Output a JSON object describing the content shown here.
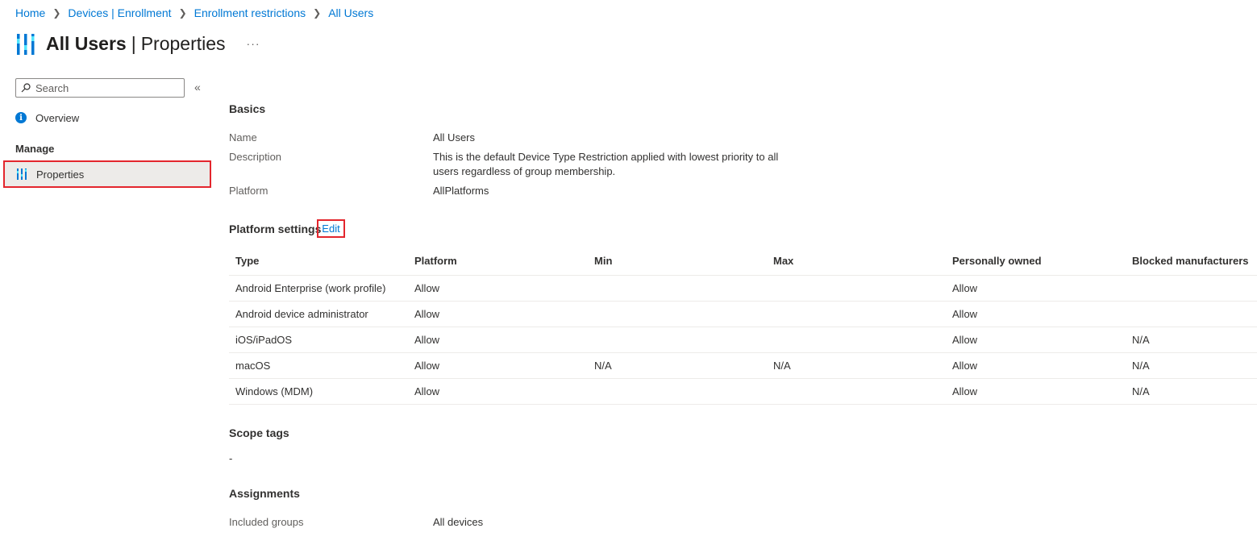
{
  "breadcrumb": [
    {
      "label": "Home"
    },
    {
      "label": "Devices | Enrollment"
    },
    {
      "label": "Enrollment restrictions"
    },
    {
      "label": "All Users"
    }
  ],
  "header": {
    "title": "All Users",
    "separator": "|",
    "subtitle": "Properties",
    "more": "···",
    "icon": "properties-bars-icon"
  },
  "sidebar": {
    "search_placeholder": "Search",
    "collapse": "«",
    "overview_label": "Overview",
    "manage_header": "Manage",
    "properties_label": "Properties"
  },
  "basics": {
    "title": "Basics",
    "name_label": "Name",
    "name_value": "All Users",
    "description_label": "Description",
    "description_value": "This is the default Device Type Restriction applied with lowest priority to all users regardless of group membership.",
    "platform_label": "Platform",
    "platform_value": "AllPlatforms"
  },
  "platform_settings": {
    "title": "Platform settings",
    "edit_label": "Edit",
    "columns": [
      "Type",
      "Platform",
      "Min",
      "Max",
      "Personally owned",
      "Blocked manufacturers"
    ],
    "rows": [
      [
        "Android Enterprise (work profile)",
        "Allow",
        "",
        "",
        "Allow",
        ""
      ],
      [
        "Android device administrator",
        "Allow",
        "",
        "",
        "Allow",
        ""
      ],
      [
        "iOS/iPadOS",
        "Allow",
        "",
        "",
        "Allow",
        "N/A"
      ],
      [
        "macOS",
        "Allow",
        "N/A",
        "N/A",
        "Allow",
        "N/A"
      ],
      [
        "Windows (MDM)",
        "Allow",
        "",
        "",
        "Allow",
        "N/A"
      ]
    ]
  },
  "scope_tags": {
    "title": "Scope tags",
    "value": "-"
  },
  "assignments": {
    "title": "Assignments",
    "included_label": "Included groups",
    "included_value": "All devices"
  },
  "colors": {
    "link": "#0078d4",
    "highlight_border": "#e3262d",
    "selected_bg": "#edebe9"
  }
}
